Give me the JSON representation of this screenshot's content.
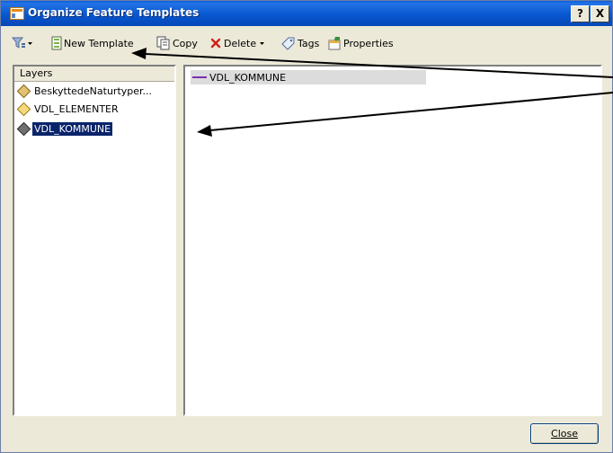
{
  "window": {
    "title": "Organize Feature Templates",
    "help_label": "?",
    "close_label": "X"
  },
  "toolbar": {
    "new_template_label": "New Template",
    "copy_label": "Copy",
    "delete_label": "Delete",
    "tags_label": "Tags",
    "properties_label": "Properties"
  },
  "layers": {
    "header": "Layers",
    "items": [
      {
        "label": "BeskyttedeNaturtyper...",
        "icon": "polygon-layer-icon",
        "selected": false
      },
      {
        "label": "VDL_ELEMENTER",
        "icon": "point-layer-icon",
        "selected": false
      },
      {
        "label": "VDL_KOMMUNE",
        "icon": "line-layer-icon",
        "selected": true
      }
    ]
  },
  "templates": {
    "items": [
      {
        "label": "VDL_KOMMUNE",
        "symbol_color": "#7d2fb0"
      }
    ]
  },
  "footer": {
    "close_label": "Close"
  },
  "colors": {
    "title_bar": "#0757d0",
    "selection": "#0a246a",
    "annotation_arrow": "#000000"
  }
}
